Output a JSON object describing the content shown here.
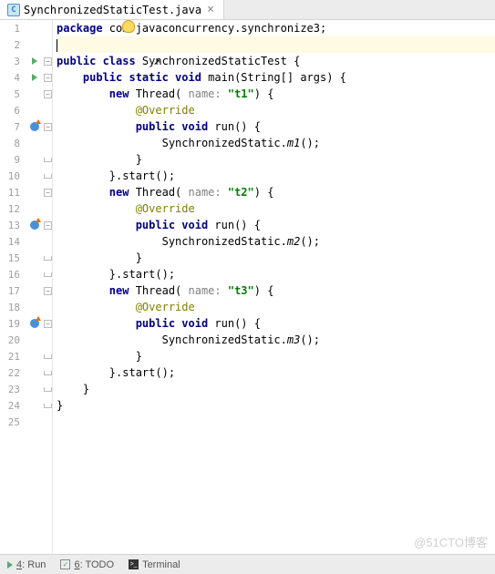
{
  "tab": {
    "filename": "SynchronizedStaticTest.java",
    "icon_letter": "C"
  },
  "code": {
    "lines": [
      {
        "n": 1,
        "indent": 0,
        "tokens": [
          [
            "kw",
            "package"
          ],
          [
            "",
            " com.javaconcurrency.synchronize3;"
          ]
        ],
        "bulb": true
      },
      {
        "n": 2,
        "indent": 0,
        "tokens": [],
        "caret": true,
        "highlight": true
      },
      {
        "n": 3,
        "indent": 0,
        "tokens": [
          [
            "kw",
            "public class"
          ],
          [
            "",
            " SynchronizedStaticTest {"
          ]
        ],
        "run": true,
        "fold": "start",
        "cursor": true
      },
      {
        "n": 4,
        "indent": 1,
        "tokens": [
          [
            "kw",
            "public static void"
          ],
          [
            "",
            " main(String[] args) {"
          ]
        ],
        "run": true,
        "fold": "start"
      },
      {
        "n": 5,
        "indent": 2,
        "tokens": [
          [
            "kw",
            "new"
          ],
          [
            "",
            " Thread("
          ],
          [
            "param",
            " name: "
          ],
          [
            "str",
            "\"t1\""
          ],
          [
            "",
            ") {"
          ]
        ],
        "fold": "start"
      },
      {
        "n": 6,
        "indent": 3,
        "tokens": [
          [
            "ann",
            "@Override"
          ]
        ]
      },
      {
        "n": 7,
        "indent": 3,
        "tokens": [
          [
            "kw",
            "public void"
          ],
          [
            "",
            " run() {"
          ]
        ],
        "override": true,
        "fold": "start"
      },
      {
        "n": 8,
        "indent": 4,
        "tokens": [
          [
            "",
            "SynchronizedStatic."
          ],
          [
            "static-call",
            "m1"
          ],
          [
            "",
            "();"
          ]
        ]
      },
      {
        "n": 9,
        "indent": 3,
        "tokens": [
          [
            "",
            "}"
          ]
        ],
        "fold": "end"
      },
      {
        "n": 10,
        "indent": 2,
        "tokens": [
          [
            "",
            "}.start();"
          ]
        ],
        "fold": "end"
      },
      {
        "n": 11,
        "indent": 2,
        "tokens": [
          [
            "kw",
            "new"
          ],
          [
            "",
            " Thread("
          ],
          [
            "param",
            " name: "
          ],
          [
            "str",
            "\"t2\""
          ],
          [
            "",
            ") {"
          ]
        ],
        "fold": "start"
      },
      {
        "n": 12,
        "indent": 3,
        "tokens": [
          [
            "ann",
            "@Override"
          ]
        ]
      },
      {
        "n": 13,
        "indent": 3,
        "tokens": [
          [
            "kw",
            "public void"
          ],
          [
            "",
            " run() {"
          ]
        ],
        "override": true,
        "fold": "start"
      },
      {
        "n": 14,
        "indent": 4,
        "tokens": [
          [
            "",
            "SynchronizedStatic."
          ],
          [
            "static-call",
            "m2"
          ],
          [
            "",
            "();"
          ]
        ]
      },
      {
        "n": 15,
        "indent": 3,
        "tokens": [
          [
            "",
            "}"
          ]
        ],
        "fold": "end"
      },
      {
        "n": 16,
        "indent": 2,
        "tokens": [
          [
            "",
            "}.start();"
          ]
        ],
        "fold": "end"
      },
      {
        "n": 17,
        "indent": 2,
        "tokens": [
          [
            "kw",
            "new"
          ],
          [
            "",
            " Thread("
          ],
          [
            "param",
            " name: "
          ],
          [
            "str",
            "\"t3\""
          ],
          [
            "",
            ") {"
          ]
        ],
        "fold": "start"
      },
      {
        "n": 18,
        "indent": 3,
        "tokens": [
          [
            "ann",
            "@Override"
          ]
        ]
      },
      {
        "n": 19,
        "indent": 3,
        "tokens": [
          [
            "kw",
            "public void"
          ],
          [
            "",
            " run() {"
          ]
        ],
        "override": true,
        "fold": "start"
      },
      {
        "n": 20,
        "indent": 4,
        "tokens": [
          [
            "",
            "SynchronizedStatic."
          ],
          [
            "static-call",
            "m3"
          ],
          [
            "",
            "();"
          ]
        ]
      },
      {
        "n": 21,
        "indent": 3,
        "tokens": [
          [
            "",
            "}"
          ]
        ],
        "fold": "end"
      },
      {
        "n": 22,
        "indent": 2,
        "tokens": [
          [
            "",
            "}.start();"
          ]
        ],
        "fold": "end"
      },
      {
        "n": 23,
        "indent": 1,
        "tokens": [
          [
            "",
            "}"
          ]
        ],
        "fold": "end"
      },
      {
        "n": 24,
        "indent": 0,
        "tokens": [
          [
            "",
            "}"
          ]
        ],
        "fold": "end"
      },
      {
        "n": 25,
        "indent": 0,
        "tokens": []
      }
    ],
    "indent_unit": "    "
  },
  "bottom": {
    "run": {
      "key": "4",
      "label": "Run"
    },
    "todo": {
      "key": "6",
      "label": "TODO"
    },
    "terminal": {
      "label": "Terminal"
    }
  },
  "watermark": "@51CTO博客"
}
